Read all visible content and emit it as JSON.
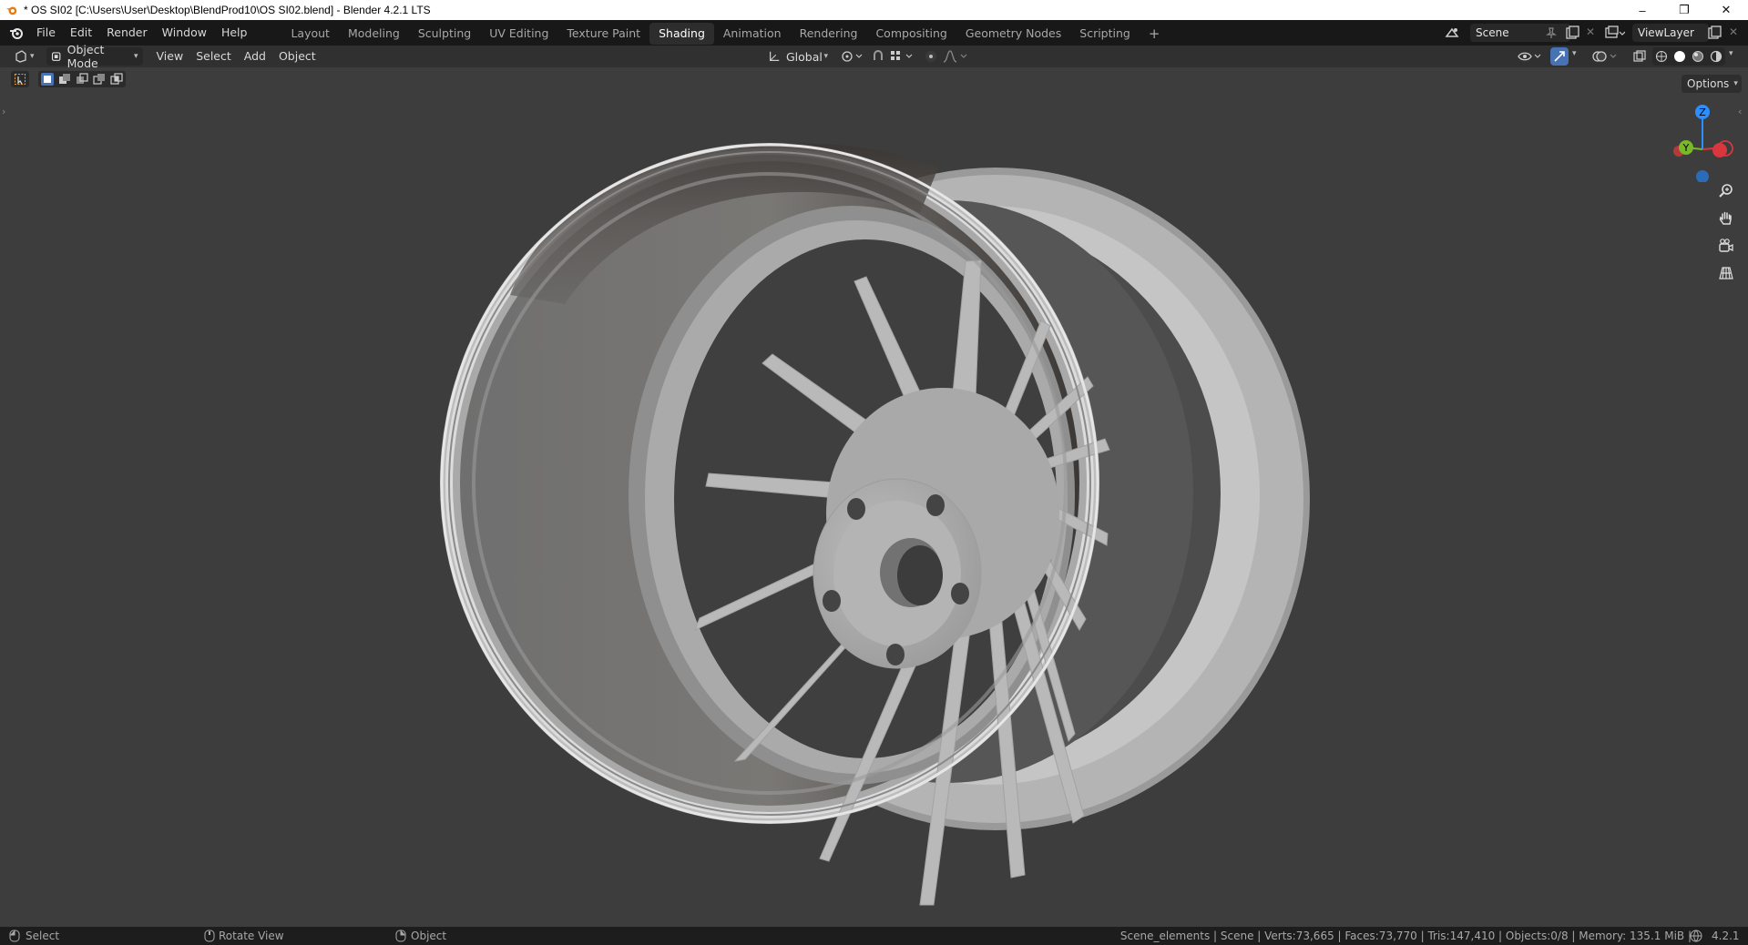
{
  "window": {
    "title": "* OS SI02 [C:\\Users\\User\\Desktop\\BlendProd10\\OS SI02.blend] - Blender 4.2.1 LTS",
    "minimize": "–",
    "maximize": "❐",
    "close": "✕"
  },
  "menu": [
    "File",
    "Edit",
    "Render",
    "Window",
    "Help"
  ],
  "workspaces": [
    "Layout",
    "Modeling",
    "Sculpting",
    "UV Editing",
    "Texture Paint",
    "Shading",
    "Animation",
    "Rendering",
    "Compositing",
    "Geometry Nodes",
    "Scripting"
  ],
  "active_workspace": "Shading",
  "add_workspace": "+",
  "scene": {
    "value": "Scene"
  },
  "view_layer": {
    "value": "ViewLayer"
  },
  "viewport_header": {
    "mode": "Object Mode",
    "menus": [
      "View",
      "Select",
      "Add",
      "Object"
    ],
    "orientation": "Global",
    "options": "Options"
  },
  "gizmo": {
    "z": "Z",
    "y": "Y",
    "x": "X"
  },
  "statusbar": {
    "left_action": "Select",
    "middle_action": "Rotate View",
    "right_action": "Object",
    "info": "Scene_elements | Scene | Verts:73,665 | Faces:73,770 | Tris:147,410 | Objects:0/8 | Memory: 135.1 MiB |",
    "version": "4.2.1"
  },
  "colors": {
    "topbar": "#181818",
    "header": "#303030",
    "viewport": "#3d3d3d",
    "axis_x": "#d9363e",
    "axis_y": "#78b82a",
    "axis_z": "#2c8fff",
    "accent": "#4772b3"
  }
}
